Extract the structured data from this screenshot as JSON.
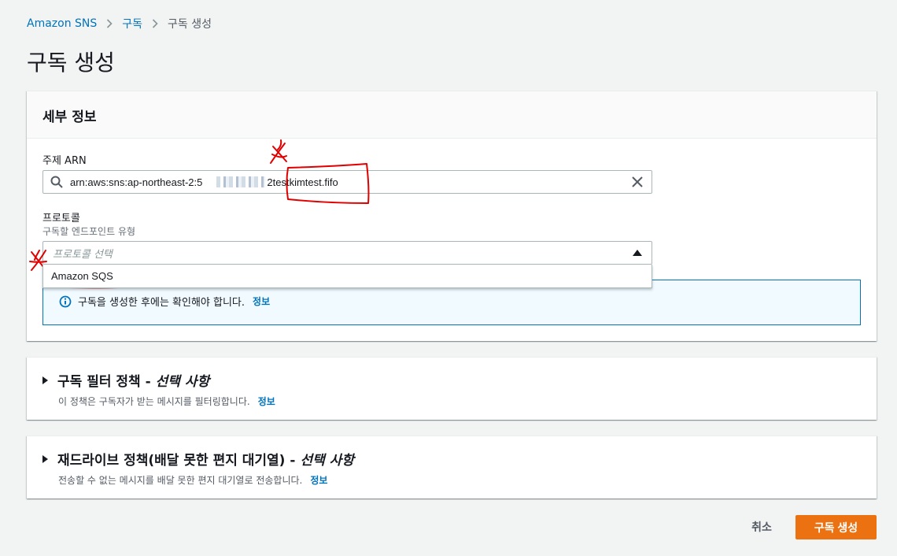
{
  "breadcrumb": {
    "items": [
      "Amazon SNS",
      "구독",
      "구독 생성"
    ]
  },
  "page": {
    "title": "구독 생성"
  },
  "details": {
    "header": "세부 정보",
    "topic_arn_label": "주제 ARN",
    "topic_arn_prefix": "arn:aws:sns:ap-northeast-2:5",
    "topic_arn_mid": "2",
    "topic_arn_suffix": "testkimtest.fifo",
    "protocol_label": "프로토콜",
    "protocol_desc": "구독할 엔드포인트 유형",
    "protocol_placeholder": "프로토콜 선택",
    "protocol_options": [
      "Amazon SQS"
    ],
    "alert_text": "구독을 생성한 후에는 확인해야 합니다.",
    "alert_link": "정보"
  },
  "filter_policy": {
    "title": "구독 필터 정책 -",
    "optional": "선택 사항",
    "desc": "이 정책은 구독자가 받는 메시지를 필터링합니다.",
    "link": "정보"
  },
  "redrive_policy": {
    "title": "재드라이브 정책(배달 못한 편지 대기열) -",
    "optional": "선택 사항",
    "desc": "전송할 수 없는 메시지를 배달 못한 편지 대기열로 전송합니다.",
    "link": "정보"
  },
  "actions": {
    "cancel": "취소",
    "create": "구독 생성"
  },
  "colors": {
    "link": "#0073bb",
    "primary_button": "#ec7211",
    "annotation": "#e00000"
  }
}
